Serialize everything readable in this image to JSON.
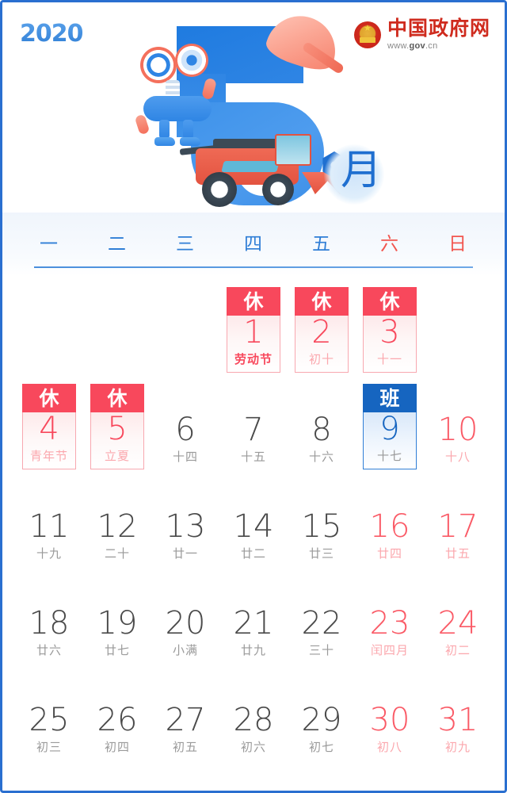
{
  "brand": {
    "year_logo": "2020",
    "gov_name": "中国政府网",
    "gov_url_prefix": "www.",
    "gov_url_mid": "gov",
    "gov_url_suffix": ".cn"
  },
  "header": {
    "month_number": "5",
    "month_char": "月",
    "accent_blue": "#2f7ed6",
    "accent_red": "#f8485c",
    "illustration": [
      "robot",
      "hard-hat",
      "combine-harvester"
    ]
  },
  "weekdays": [
    {
      "label": "一",
      "weekend": false
    },
    {
      "label": "二",
      "weekend": false
    },
    {
      "label": "三",
      "weekend": false
    },
    {
      "label": "四",
      "weekend": false
    },
    {
      "label": "五",
      "weekend": false
    },
    {
      "label": "六",
      "weekend": true
    },
    {
      "label": "日",
      "weekend": true
    }
  ],
  "badges": {
    "rest": "休",
    "work": "班"
  },
  "weeks": [
    [
      {
        "day": "",
        "lunar": "",
        "type": "empty"
      },
      {
        "day": "",
        "lunar": "",
        "type": "empty"
      },
      {
        "day": "",
        "lunar": "",
        "type": "empty"
      },
      {
        "day": "1",
        "lunar": "劳动节",
        "type": "rest",
        "festival": true
      },
      {
        "day": "2",
        "lunar": "初十",
        "type": "rest",
        "festival": false
      },
      {
        "day": "3",
        "lunar": "十一",
        "type": "rest",
        "festival": false
      }
    ],
    [
      {
        "day": "4",
        "lunar": "青年节",
        "type": "rest",
        "festival": false
      },
      {
        "day": "5",
        "lunar": "立夏",
        "type": "rest",
        "festival": false
      },
      {
        "day": "6",
        "lunar": "十四",
        "type": "normal"
      },
      {
        "day": "7",
        "lunar": "十五",
        "type": "normal"
      },
      {
        "day": "8",
        "lunar": "十六",
        "type": "normal"
      },
      {
        "day": "9",
        "lunar": "十七",
        "type": "work"
      },
      {
        "day": "10",
        "lunar": "十八",
        "type": "weekend"
      }
    ],
    [
      {
        "day": "11",
        "lunar": "十九",
        "type": "normal"
      },
      {
        "day": "12",
        "lunar": "二十",
        "type": "normal"
      },
      {
        "day": "13",
        "lunar": "廿一",
        "type": "normal"
      },
      {
        "day": "14",
        "lunar": "廿二",
        "type": "normal"
      },
      {
        "day": "15",
        "lunar": "廿三",
        "type": "normal"
      },
      {
        "day": "16",
        "lunar": "廿四",
        "type": "weekend"
      },
      {
        "day": "17",
        "lunar": "廿五",
        "type": "weekend"
      }
    ],
    [
      {
        "day": "18",
        "lunar": "廿六",
        "type": "normal"
      },
      {
        "day": "19",
        "lunar": "廿七",
        "type": "normal"
      },
      {
        "day": "20",
        "lunar": "小满",
        "type": "normal"
      },
      {
        "day": "21",
        "lunar": "廿九",
        "type": "normal"
      },
      {
        "day": "22",
        "lunar": "三十",
        "type": "normal"
      },
      {
        "day": "23",
        "lunar": "闰四月",
        "type": "weekend"
      },
      {
        "day": "24",
        "lunar": "初二",
        "type": "weekend"
      }
    ],
    [
      {
        "day": "25",
        "lunar": "初三",
        "type": "normal"
      },
      {
        "day": "26",
        "lunar": "初四",
        "type": "normal"
      },
      {
        "day": "27",
        "lunar": "初五",
        "type": "normal"
      },
      {
        "day": "28",
        "lunar": "初六",
        "type": "normal"
      },
      {
        "day": "29",
        "lunar": "初七",
        "type": "normal"
      },
      {
        "day": "30",
        "lunar": "初八",
        "type": "weekend"
      },
      {
        "day": "31",
        "lunar": "初九",
        "type": "weekend"
      }
    ]
  ]
}
